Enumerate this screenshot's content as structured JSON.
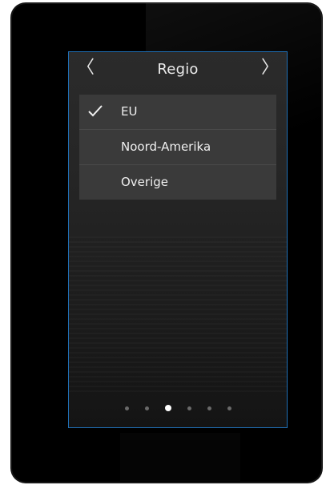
{
  "header": {
    "title": "Regio",
    "prev_icon": "chevron-left-icon",
    "next_icon": "chevron-right-icon",
    "prev_glyph": "〈",
    "next_glyph": "〉"
  },
  "regions": [
    {
      "label": "EU",
      "selected": true
    },
    {
      "label": "Noord-Amerika",
      "selected": false
    },
    {
      "label": "Overige",
      "selected": false
    }
  ],
  "pagination": {
    "count": 6,
    "active_index": 2
  },
  "colors": {
    "accent_border": "#1f6fb5",
    "list_bg": "#3a3a3a",
    "text": "#f0f0f0"
  }
}
